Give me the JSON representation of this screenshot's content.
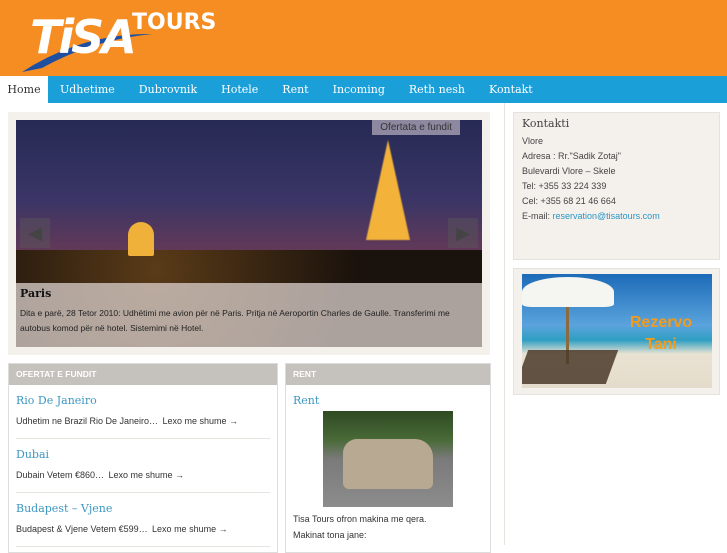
{
  "header": {
    "logo_text": "TISA TOURS"
  },
  "nav": {
    "items": [
      "Home",
      "Udhetime",
      "Dubrovnik",
      "Hotele",
      "Rent",
      "Incoming",
      "Reth nesh",
      "Kontakt"
    ]
  },
  "slider": {
    "badge": "Ofertata e fundit",
    "title": "Paris",
    "text": "Dita e parë, 28 Tetor 2010: Udhëtimi me avion për në Paris. Pritja në Aeroportin Charles de Gaulle. Transferimi me autobus komod për në hotel. Sistemimi në Hotel.",
    "prev": "◀",
    "next": "▶"
  },
  "kontakti": {
    "title": "Kontakti",
    "city": "Vlore",
    "address": "Adresa : Rr.\"Sadik Zotaj\"",
    "street": "Bulevardi Vlore – Skele",
    "tel": "Tel: +355 33 224 339",
    "cel": "Cel: +355 68 21 46 664",
    "email_label": "E-mail: ",
    "email": "reservation@tisatours.com"
  },
  "banner": {
    "line1": "Rezervo",
    "line2": "Tani"
  },
  "ofertat": {
    "title": "OFERTAT E FUNDIT",
    "more": "Lexo me shume →",
    "items": [
      {
        "title": "Rio De Janeiro",
        "text": "Udhetim ne Brazil Rio De Janeiro…"
      },
      {
        "title": "Dubai",
        "text": "Dubain Vetem €860…"
      },
      {
        "title": "Budapest – Vjene",
        "text": "Budapest & Vjene Vetem €599…"
      }
    ]
  },
  "rent": {
    "title": "RENT",
    "item_title": "Rent",
    "line1": "Tisa Tours ofron makina me qera.",
    "line2": "Makinat tona jane:"
  }
}
